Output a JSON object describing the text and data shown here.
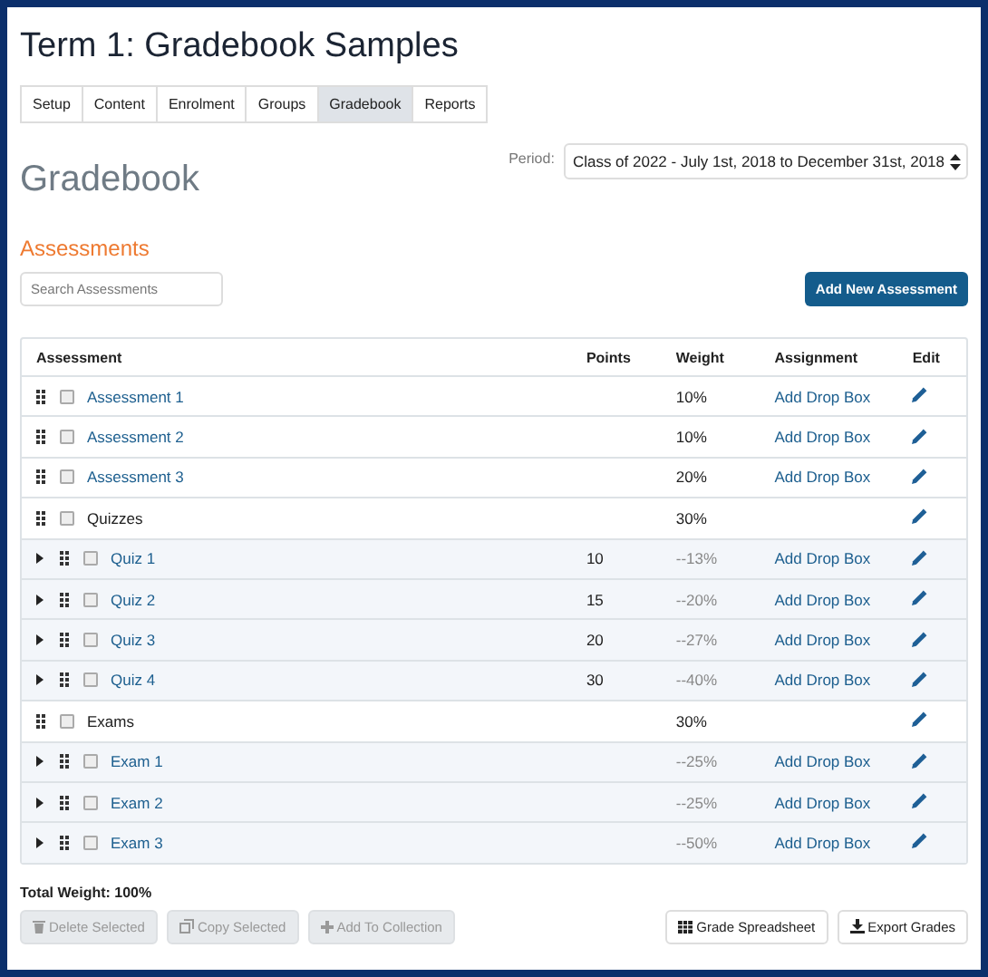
{
  "page": {
    "title": "Term 1: Gradebook Samples"
  },
  "tabs": [
    {
      "label": "Setup",
      "selected": false
    },
    {
      "label": "Content",
      "selected": false
    },
    {
      "label": "Enrolment",
      "selected": false
    },
    {
      "label": "Groups",
      "selected": false
    },
    {
      "label": "Gradebook",
      "selected": true
    },
    {
      "label": "Reports",
      "selected": false
    }
  ],
  "heading": "Gradebook",
  "period": {
    "label": "Period:",
    "value": "Class of 2022 - July 1st, 2018 to December 31st, 2018"
  },
  "section_title": "Assessments",
  "search": {
    "placeholder": "Search Assessments"
  },
  "add_button": "Add New Assessment",
  "table": {
    "columns": [
      "Assessment",
      "Points",
      "Weight",
      "Assignment",
      "Edit"
    ],
    "rows": [
      {
        "kind": "item",
        "name": "Assessment 1",
        "weight": "10%",
        "assignment": "Add Drop Box",
        "checked": false
      },
      {
        "kind": "item",
        "name": "Assessment 2",
        "weight": "10%",
        "assignment": "Add Drop Box",
        "checked": false
      },
      {
        "kind": "item",
        "name": "Assessment 3",
        "weight": "20%",
        "assignment": "Add Drop Box",
        "checked": false
      },
      {
        "kind": "group",
        "name": "Quizzes",
        "weight": "30%",
        "checked": false
      },
      {
        "kind": "child",
        "name": "Quiz 1",
        "points": "10",
        "weight": "--13%",
        "assignment": "Add Drop Box",
        "checked": false
      },
      {
        "kind": "child",
        "name": "Quiz 2",
        "points": "15",
        "weight": "--20%",
        "assignment": "Add Drop Box",
        "checked": false
      },
      {
        "kind": "child",
        "name": "Quiz 3",
        "points": "20",
        "weight": "--27%",
        "assignment": "Add Drop Box",
        "checked": false
      },
      {
        "kind": "child",
        "name": "Quiz 4",
        "points": "30",
        "weight": "--40%",
        "assignment": "Add Drop Box",
        "checked": false
      },
      {
        "kind": "group",
        "name": "Exams",
        "weight": "30%",
        "checked": false
      },
      {
        "kind": "child",
        "name": "Exam 1",
        "weight": "--25%",
        "assignment": "Add Drop Box",
        "checked": false
      },
      {
        "kind": "child",
        "name": "Exam 2",
        "weight": "--25%",
        "assignment": "Add Drop Box",
        "checked": false
      },
      {
        "kind": "child",
        "name": "Exam 3",
        "weight": "--50%",
        "assignment": "Add Drop Box",
        "checked": false
      }
    ]
  },
  "total": "Total Weight: 100%",
  "left_buttons": [
    {
      "kind": "delete",
      "label": "Delete Selected",
      "disabled": true
    },
    {
      "kind": "copy",
      "label": "Copy Selected",
      "disabled": true
    },
    {
      "kind": "add",
      "label": "Add To Collection",
      "disabled": true
    }
  ],
  "right_buttons": [
    {
      "kind": "spreadsheet",
      "label": "Grade Spreadsheet",
      "disabled": false
    },
    {
      "kind": "export",
      "label": "Export Grades",
      "disabled": false
    }
  ]
}
